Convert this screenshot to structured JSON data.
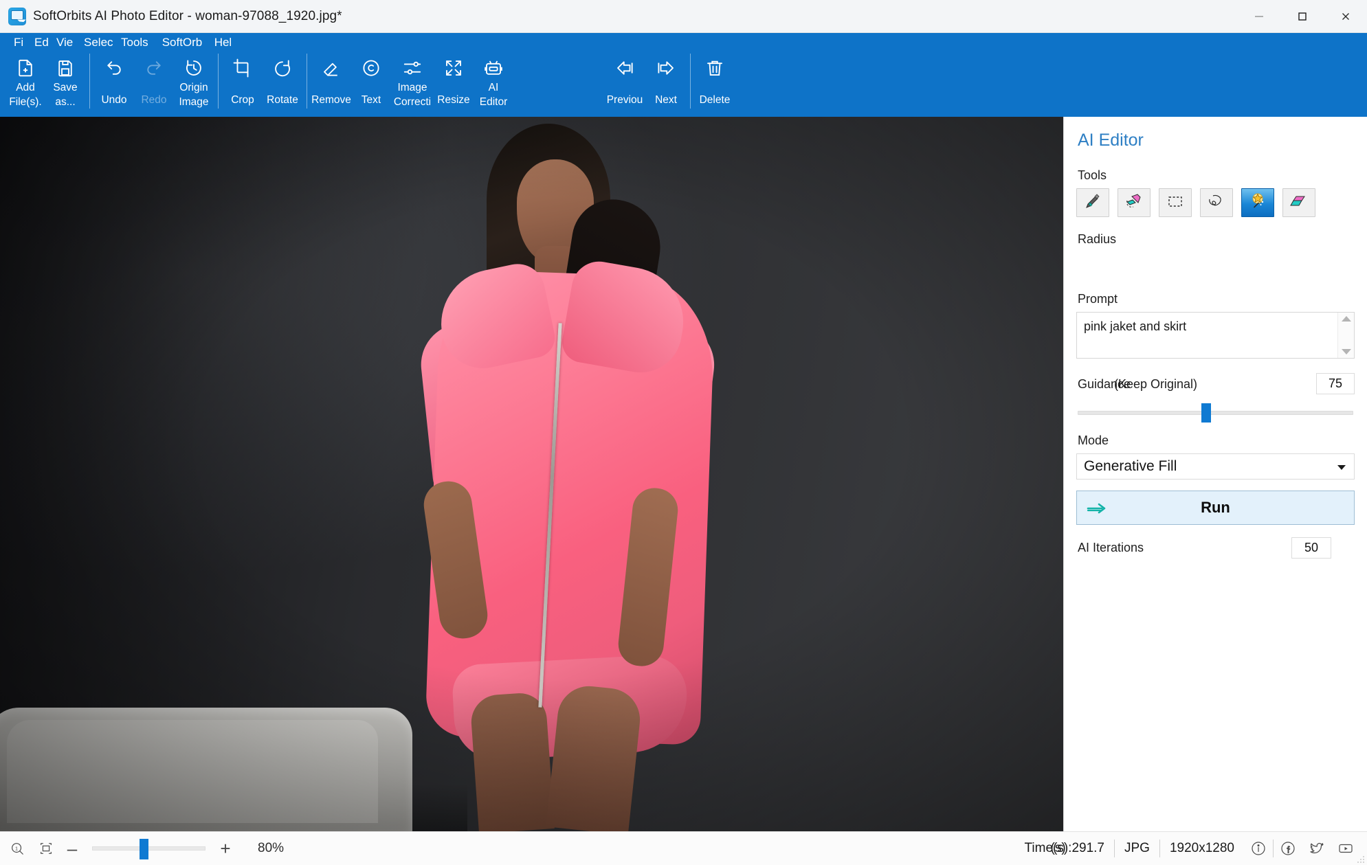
{
  "window": {
    "title": "SoftOrbits AI Photo Editor - woman-97088_1920.jpg*",
    "app_icon": "photo-editor-icon",
    "minimize": "–",
    "maximize": "□",
    "close": "✕"
  },
  "menu": [
    {
      "label": "File",
      "clipped": "Fi"
    },
    {
      "label": "Edit",
      "clipped": "Ed"
    },
    {
      "label": "View",
      "clipped": "Vie"
    },
    {
      "label": "Select",
      "clipped": "Selec"
    },
    {
      "label": "Tools",
      "clipped": "Tools"
    },
    {
      "label": "SoftOrbits",
      "clipped": "SoftOrb"
    },
    {
      "label": "Help",
      "clipped": "Hel"
    }
  ],
  "toolbar": {
    "groups": [
      {
        "items": [
          {
            "label": "Add File(s)...",
            "line1": "Add",
            "line2": "File(s).",
            "icon": "add-file-icon",
            "disabled": false
          },
          {
            "label": "Save as...",
            "line1": "Save",
            "line2": "as...",
            "icon": "save-icon",
            "disabled": false
          }
        ]
      },
      {
        "items": [
          {
            "label": "Undo",
            "line1": "Undo",
            "line2": "",
            "icon": "undo-icon",
            "disabled": false
          },
          {
            "label": "Redo",
            "line1": "Redo",
            "line2": "",
            "icon": "redo-icon",
            "disabled": true
          },
          {
            "label": "Original Image",
            "line1": "Origin",
            "line2": "Image",
            "icon": "original-image-icon",
            "disabled": false
          }
        ]
      },
      {
        "items": [
          {
            "label": "Crop",
            "line1": "Crop",
            "line2": "",
            "icon": "crop-icon",
            "disabled": false
          },
          {
            "label": "Rotate",
            "line1": "Rotate",
            "line2": "",
            "icon": "rotate-icon",
            "disabled": false
          }
        ]
      },
      {
        "items": [
          {
            "label": "Remove",
            "line1": "Remove",
            "line2": "",
            "icon": "eraser-icon",
            "disabled": false
          },
          {
            "label": "Text",
            "line1": "Text",
            "line2": "",
            "icon": "copyright-icon",
            "disabled": false
          },
          {
            "label": "Image Correction",
            "line1": "Image",
            "line2": "Correcti",
            "icon": "sliders-icon",
            "disabled": false
          },
          {
            "label": "Resize",
            "line1": "Resize",
            "line2": "",
            "icon": "resize-icon",
            "disabled": false
          },
          {
            "label": "AI Editor",
            "line1": "AI",
            "line2": "Editor",
            "icon": "robot-icon",
            "disabled": false
          }
        ]
      },
      {
        "items": [
          {
            "label": "Previous",
            "line1": "Previou",
            "line2": "",
            "icon": "arrow-left-icon",
            "disabled": false
          },
          {
            "label": "Next",
            "line1": "Next",
            "line2": "",
            "icon": "arrow-right-icon",
            "disabled": false
          }
        ]
      },
      {
        "items": [
          {
            "label": "Delete",
            "line1": "Delete",
            "line2": "",
            "icon": "trash-icon",
            "disabled": false
          }
        ]
      }
    ]
  },
  "panel": {
    "title": "AI Editor",
    "tools_label": "Tools",
    "tools": [
      {
        "name": "brush-tool",
        "icon": "brush-icon",
        "active": false
      },
      {
        "name": "eraser-tool",
        "icon": "eraser-stroke-icon",
        "active": false
      },
      {
        "name": "rectangle-select-tool",
        "icon": "marquee-icon",
        "active": false
      },
      {
        "name": "lasso-tool",
        "icon": "lasso-icon",
        "active": false
      },
      {
        "name": "magic-wand-tool",
        "icon": "magic-wand-icon",
        "active": true
      },
      {
        "name": "fill-tool",
        "icon": "color-fill-icon",
        "active": false
      }
    ],
    "radius_label": "Radius",
    "prompt_label": "Prompt",
    "prompt_value": "pink jaket and skirt",
    "guidance_label": "Guidance",
    "keep_original_label": "(Keep Original)",
    "guidance_value": "75",
    "guidance_slider_pct": 45,
    "mode_label": "Mode",
    "mode_value": "Generative Fill",
    "run_label": "Run",
    "iterations_label": "AI Iterations",
    "iterations_value": "50"
  },
  "statusbar": {
    "zoom_icon": "zoom-one-to-one-icon",
    "fit_icon": "fit-to-window-icon",
    "minus": "–",
    "plus": "+",
    "zoom_pct": "80%",
    "zoom_slider_pct": 42,
    "time_label": "Time(s):291.7",
    "time_overlap": "(s)",
    "format": "JPG",
    "dimensions": "1920x1280",
    "icons": [
      {
        "name": "info-icon"
      },
      {
        "name": "facebook-icon"
      },
      {
        "name": "twitter-icon"
      },
      {
        "name": "youtube-icon"
      }
    ]
  },
  "colors": {
    "accent_blue": "#0e73c8",
    "panel_title_blue": "#2e7fc4",
    "slider_blue": "#0f7ad2",
    "run_bg": "#e3f1fb"
  }
}
